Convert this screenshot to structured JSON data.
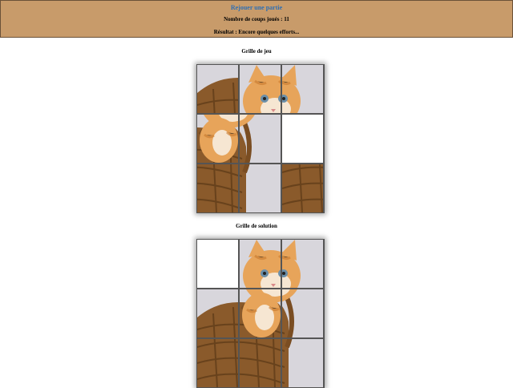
{
  "header": {
    "replay_label": "Rejouer une partie",
    "moves_text": "Nombre de coups joués : 11",
    "result_text": "Résultat : Encore quelques efforts..."
  },
  "game_grid": {
    "title": "Grille de jeu",
    "tiles": [
      {
        "piece": 4
      },
      {
        "piece": 2
      },
      {
        "piece": 3
      },
      {
        "piece": 5
      },
      {
        "piece": 6
      },
      {
        "piece": null
      },
      {
        "piece": 8
      },
      {
        "piece": 9
      },
      {
        "piece": 7
      }
    ]
  },
  "solution_grid": {
    "title": "Grille de solution",
    "tiles": [
      {
        "piece": null
      },
      {
        "piece": 2
      },
      {
        "piece": 3
      },
      {
        "piece": 4
      },
      {
        "piece": 5
      },
      {
        "piece": 6
      },
      {
        "piece": 7
      },
      {
        "piece": 8
      },
      {
        "piece": 9
      }
    ]
  },
  "colors": {
    "panel_bg": "#c89b6a",
    "link": "#2f6fb3",
    "fur": "#e7a45a",
    "basket": "#8a5a2b",
    "backdrop": "#d8d6dc"
  }
}
